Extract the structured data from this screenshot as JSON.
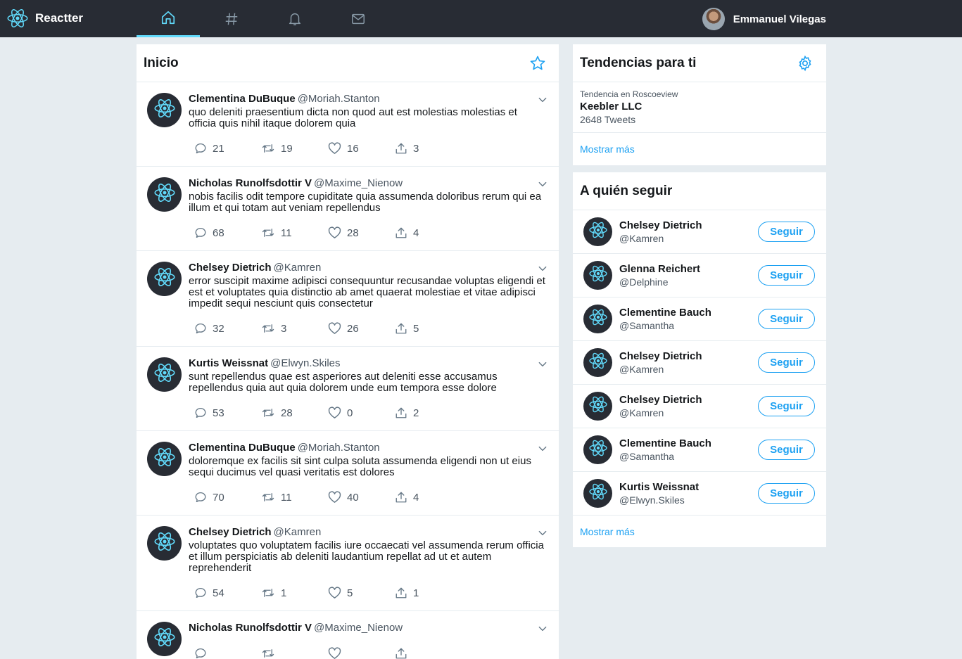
{
  "app": {
    "name": "Reactter"
  },
  "nav": {
    "tabs": [
      {
        "icon": "home-icon",
        "active": true
      },
      {
        "icon": "hashtag-icon",
        "active": false
      },
      {
        "icon": "bell-icon",
        "active": false
      },
      {
        "icon": "mail-icon",
        "active": false
      }
    ],
    "user": {
      "name": "Emmanuel Vilegas"
    }
  },
  "feed": {
    "title": "Inicio",
    "tweets": [
      {
        "name": "Clementina DuBuque",
        "handle": "@Moriah.Stanton",
        "text": "quo deleniti praesentium dicta non quod aut est molestias molestias et officia quis nihil itaque dolorem quia",
        "replies": "21",
        "retweets": "19",
        "likes": "16",
        "shares": "3"
      },
      {
        "name": "Nicholas Runolfsdottir V",
        "handle": "@Maxime_Nienow",
        "text": "nobis facilis odit tempore cupiditate quia assumenda doloribus rerum qui ea illum et qui totam aut veniam repellendus",
        "replies": "68",
        "retweets": "11",
        "likes": "28",
        "shares": "4"
      },
      {
        "name": "Chelsey Dietrich",
        "handle": "@Kamren",
        "text": "error suscipit maxime adipisci consequuntur recusandae voluptas eligendi et est et voluptates quia distinctio ab amet quaerat molestiae et vitae adipisci impedit sequi nesciunt quis consectetur",
        "replies": "32",
        "retweets": "3",
        "likes": "26",
        "shares": "5"
      },
      {
        "name": "Kurtis Weissnat",
        "handle": "@Elwyn.Skiles",
        "text": "sunt repellendus quae est asperiores aut deleniti esse accusamus repellendus quia aut quia dolorem unde eum tempora esse dolore",
        "replies": "53",
        "retweets": "28",
        "likes": "0",
        "shares": "2"
      },
      {
        "name": "Clementina DuBuque",
        "handle": "@Moriah.Stanton",
        "text": "doloremque ex facilis sit sint culpa soluta assumenda eligendi non ut eius sequi ducimus vel quasi veritatis est dolores",
        "replies": "70",
        "retweets": "11",
        "likes": "40",
        "shares": "4"
      },
      {
        "name": "Chelsey Dietrich",
        "handle": "@Kamren",
        "text": "voluptates quo voluptatem facilis iure occaecati vel assumenda rerum officia et illum perspiciatis ab deleniti laudantium repellat ad ut et autem reprehenderit",
        "replies": "54",
        "retweets": "1",
        "likes": "5",
        "shares": "1"
      },
      {
        "name": "Nicholas Runolfsdottir V",
        "handle": "@Maxime_Nienow",
        "text": "",
        "replies": "",
        "retweets": "",
        "likes": "",
        "shares": ""
      }
    ]
  },
  "trends": {
    "title": "Tendencias para ti",
    "items": [
      {
        "location": "Tendencia en Roscoeview",
        "name": "Keebler LLC",
        "count": "2648 Tweets"
      }
    ],
    "more": "Mostrar más"
  },
  "who_to_follow": {
    "title": "A quién seguir",
    "button_label": "Seguir",
    "users": [
      {
        "name": "Chelsey Dietrich",
        "handle": "@Kamren"
      },
      {
        "name": "Glenna Reichert",
        "handle": "@Delphine"
      },
      {
        "name": "Clementine Bauch",
        "handle": "@Samantha"
      },
      {
        "name": "Chelsey Dietrich",
        "handle": "@Kamren"
      },
      {
        "name": "Chelsey Dietrich",
        "handle": "@Kamren"
      },
      {
        "name": "Clementine Bauch",
        "handle": "@Samantha"
      },
      {
        "name": "Kurtis Weissnat",
        "handle": "@Elwyn.Skiles"
      }
    ],
    "more": "Mostrar más"
  },
  "colors": {
    "navbar": "#282c34",
    "accent": "#1da1f2",
    "react": "#61dafb",
    "background": "#e6ecf0"
  }
}
